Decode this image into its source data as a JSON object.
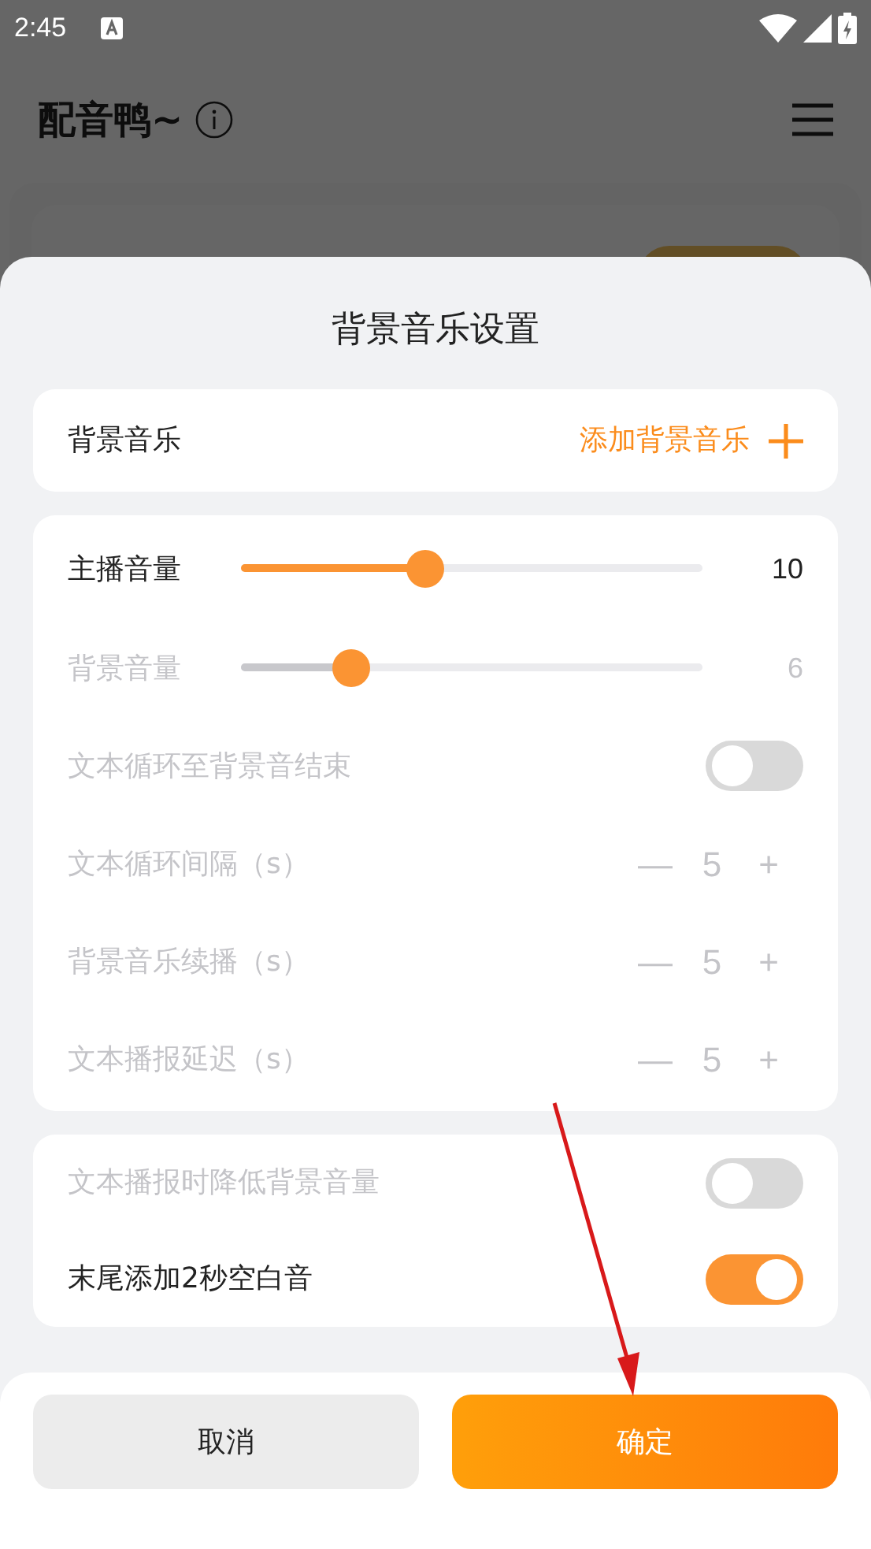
{
  "status_bar": {
    "time": "2:45"
  },
  "app_bar": {
    "title": "配音鸭~"
  },
  "sheet": {
    "title": "背景音乐设置",
    "music_row": {
      "label": "背景音乐",
      "action": "添加背景音乐"
    },
    "settings": [
      {
        "kind": "slider",
        "label": "主播音量",
        "level": 0.4,
        "reading": "10",
        "disabled": false
      },
      {
        "kind": "slider",
        "label": "背景音量",
        "level": 0.24,
        "reading": "6",
        "disabled": true
      },
      {
        "kind": "toggle",
        "label": "文本循环至背景音结束",
        "on": false,
        "disabled": true
      },
      {
        "kind": "stepper",
        "label": "文本循环间隔（s）",
        "minus": "—",
        "value": "5",
        "plus": "+",
        "disabled": true
      },
      {
        "kind": "stepper",
        "label": "背景音乐续播（s）",
        "minus": "—",
        "value": "5",
        "plus": "+",
        "disabled": true
      },
      {
        "kind": "stepper",
        "label": "文本播报延迟（s）",
        "minus": "—",
        "value": "5",
        "plus": "+",
        "disabled": true
      }
    ],
    "extra_settings": [
      {
        "kind": "toggle",
        "label": "文本播报时降低背景音量",
        "on": false,
        "disabled": true
      },
      {
        "kind": "toggle",
        "label": "末尾添加2秒空白音",
        "on": true,
        "disabled": false
      }
    ],
    "buttons": [
      {
        "label": "取消",
        "kind": "secondary"
      },
      {
        "label": "确定",
        "kind": "primary"
      }
    ]
  },
  "annotation": {
    "kind": "arrow"
  }
}
